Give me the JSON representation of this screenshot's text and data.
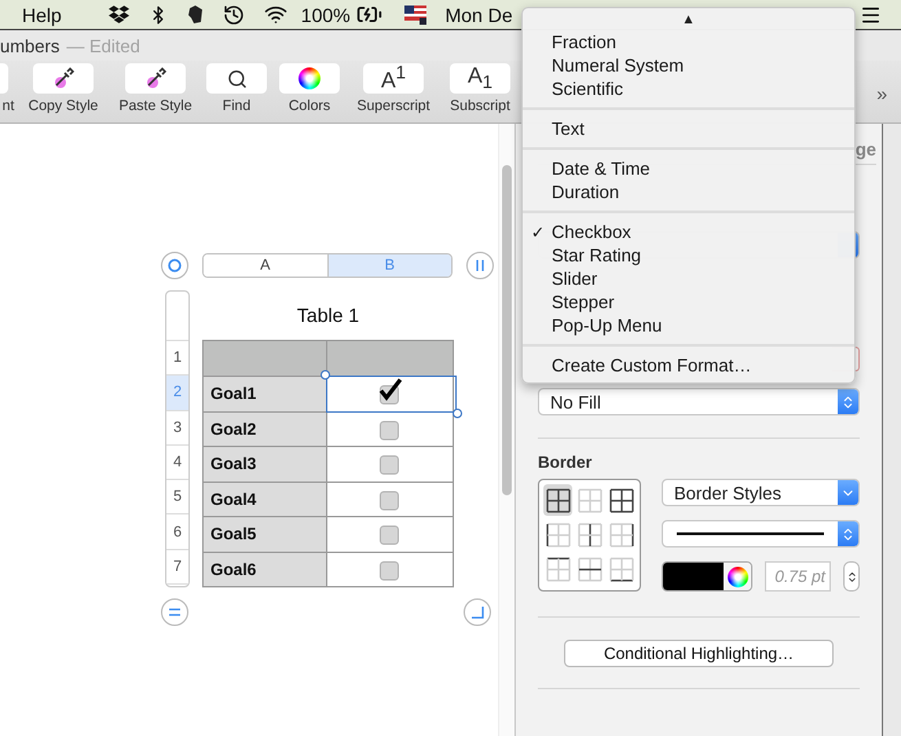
{
  "menubar": {
    "menu_label": "Help",
    "battery_text": "100%",
    "clock_text": "Mon De"
  },
  "window": {
    "title": "umbers",
    "status": "— Edited"
  },
  "toolbar": {
    "items": [
      {
        "kind": "partial",
        "label": "nt"
      },
      {
        "kind": "eyedropper",
        "label": "Copy Style"
      },
      {
        "kind": "eyedropper",
        "label": "Paste Style"
      },
      {
        "kind": "search",
        "label": "Find"
      },
      {
        "kind": "colors",
        "label": "Colors"
      },
      {
        "kind": "glyph",
        "glyph": "A$^{1}$",
        "label": "Superscript"
      },
      {
        "kind": "glyph",
        "glyph": "A$_{1}$",
        "label": "Subscript"
      }
    ],
    "overflow": "»"
  },
  "table": {
    "title": "Table 1",
    "columns": [
      {
        "label": "A",
        "selected": false
      },
      {
        "label": "B",
        "selected": true
      }
    ],
    "row_headers": [
      {
        "label": "1",
        "selected": false
      },
      {
        "label": "2",
        "selected": true
      },
      {
        "label": "3",
        "selected": false
      },
      {
        "label": "4",
        "selected": false
      },
      {
        "label": "5",
        "selected": false
      },
      {
        "label": "6",
        "selected": false
      },
      {
        "label": "7",
        "selected": false
      }
    ],
    "rows": [
      {
        "label": "Goal1",
        "checked": true,
        "selected": true
      },
      {
        "label": "Goal2",
        "checked": false,
        "selected": false
      },
      {
        "label": "Goal3",
        "checked": false,
        "selected": false
      },
      {
        "label": "Goal4",
        "checked": false,
        "selected": false
      },
      {
        "label": "Goal5",
        "checked": false,
        "selected": false
      },
      {
        "label": "Goal6",
        "checked": false,
        "selected": false
      }
    ]
  },
  "inspector": {
    "tab_fragment": "ge",
    "fill_popup": "No Fill",
    "border": {
      "title": "Border",
      "presets": [
        {
          "kind": "all",
          "selected": true
        },
        {
          "kind": "inner",
          "selected": false
        },
        {
          "kind": "outer",
          "selected": false
        },
        {
          "kind": "left",
          "selected": false
        },
        {
          "kind": "center-vertical",
          "selected": false
        },
        {
          "kind": "right",
          "selected": false
        },
        {
          "kind": "top",
          "selected": false
        },
        {
          "kind": "center-horizontal",
          "selected": false
        },
        {
          "kind": "bottom",
          "selected": false
        }
      ],
      "style_popup": "Border Styles",
      "color": "#000000",
      "width_value": "0.75 pt"
    },
    "highlight_button": "Conditional Highlighting…"
  },
  "format_menu": {
    "scroll_arrow": "▲",
    "check_mark": "✓",
    "groups": [
      [
        {
          "label": "Fraction",
          "checked": false
        },
        {
          "label": "Numeral System",
          "checked": false
        },
        {
          "label": "Scientific",
          "checked": false
        }
      ],
      [
        {
          "label": "Text",
          "checked": false
        }
      ],
      [
        {
          "label": "Date & Time",
          "checked": false
        },
        {
          "label": "Duration",
          "checked": false
        }
      ],
      [
        {
          "label": "Checkbox",
          "checked": true
        },
        {
          "label": "Star Rating",
          "checked": false
        },
        {
          "label": "Slider",
          "checked": false
        },
        {
          "label": "Stepper",
          "checked": false
        },
        {
          "label": "Pop-Up Menu",
          "checked": false
        }
      ],
      [
        {
          "label": "Create Custom Format…",
          "checked": false
        }
      ]
    ]
  }
}
